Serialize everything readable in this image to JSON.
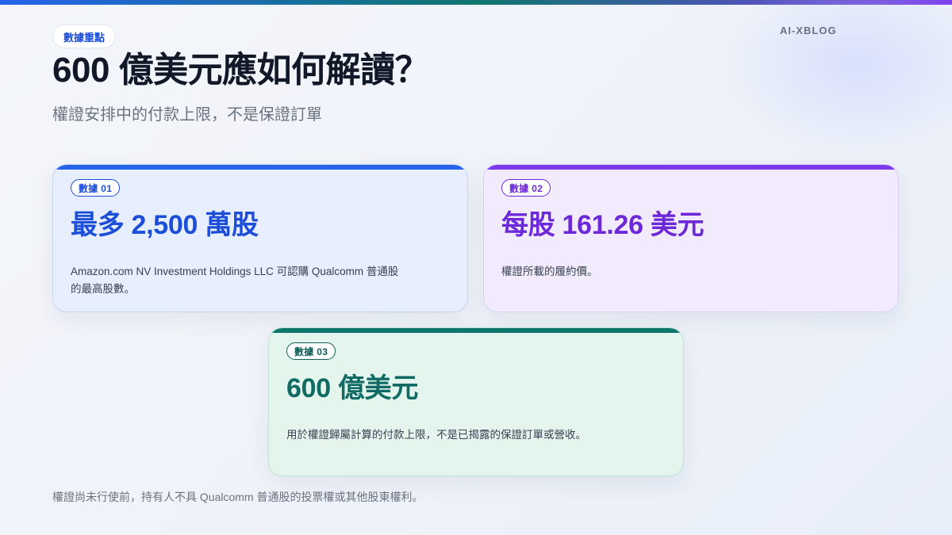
{
  "brand": "AI-XBLOG",
  "header": {
    "pill": "數據重點",
    "title": "600 億美元應如何解讀？",
    "subtitle": "權證安排中的付款上限，不是保證訂單"
  },
  "cards": [
    {
      "tag": "數據 01",
      "value": "最多 2,500 萬股",
      "description": "Amazon.com NV Investment Holdings LLC 可認購 Qualcomm 普通股的最高股數。",
      "accent_color": "#2563eb"
    },
    {
      "tag": "數據 02",
      "value": "每股 161.26 美元",
      "description": "權證所載的履約價。",
      "accent_color": "#7c3aed"
    },
    {
      "tag": "數據 03",
      "value": "600 億美元",
      "description": "用於權證歸屬計算的付款上限，不是已揭露的保證訂單或營收。",
      "accent_color": "#0f766e"
    }
  ],
  "footnote": "權證尚未行使前，持有人不具 Qualcomm 普通股的投票權或其他股東權利。"
}
